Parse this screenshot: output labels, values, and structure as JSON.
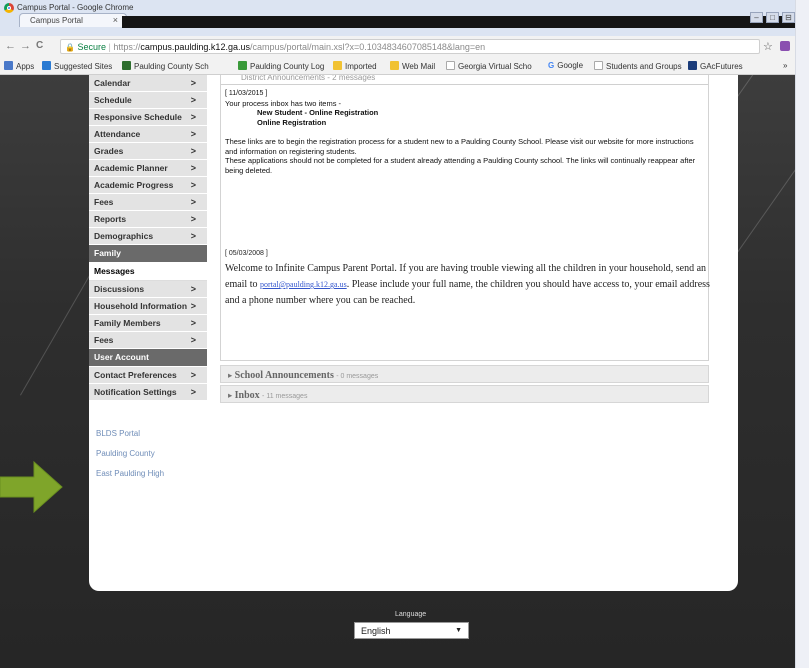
{
  "window": {
    "title": "Campus Portal - Google Chrome",
    "tab_title": "Campus Portal",
    "tab_close": "×",
    "buttons": [
      "–",
      "□",
      "⊟"
    ]
  },
  "toolbar": {
    "back": "←",
    "forward": "→",
    "reload": "C",
    "secure_label": "Secure",
    "url_scheme": "https://",
    "url_host": "campus.paulding.k12.ga.us",
    "url_rest": "/campus/portal/main.xsl?x=0.1034834607085148&lang=en",
    "star": "☆"
  },
  "bookmarks": [
    {
      "label": "Apps",
      "color": "#4a79c9"
    },
    {
      "label": "Suggested Sites",
      "color": "#2a7ad2"
    },
    {
      "label": "Paulding County Sch",
      "color": "#2e6e2e"
    },
    {
      "label": "Paulding County Log",
      "color": "#3a9a3a"
    },
    {
      "label": "Imported",
      "color": "#f1c232"
    },
    {
      "label": "Web Mail",
      "color": "#f1c232"
    },
    {
      "label": "Georgia Virtual Scho",
      "color": "#ffffff"
    },
    {
      "label": "Google",
      "color": "#4285f4"
    },
    {
      "label": "Students and Groups",
      "color": "#ffffff"
    },
    {
      "label": "GAcFutures",
      "color": "#1b3c7a"
    },
    {
      "label": "»",
      "color": ""
    }
  ],
  "sidebar": {
    "items_top": [
      {
        "label": "Calendar"
      },
      {
        "label": "Schedule"
      },
      {
        "label": "Responsive Schedule"
      },
      {
        "label": "Attendance"
      },
      {
        "label": "Grades"
      },
      {
        "label": "Academic Planner"
      },
      {
        "label": "Academic Progress"
      },
      {
        "label": "Fees"
      },
      {
        "label": "Reports"
      },
      {
        "label": "Demographics"
      }
    ],
    "family_header": "Family",
    "active_item": "Messages",
    "items_family": [
      {
        "label": "Discussions"
      },
      {
        "label": "Household Information"
      },
      {
        "label": "Family Members"
      },
      {
        "label": "Fees"
      }
    ],
    "account_header": "User Account",
    "items_account": [
      {
        "label": "Contact Preferences"
      },
      {
        "label": "Notification Settings"
      }
    ],
    "links": [
      "BLDS Portal",
      "Paulding County",
      "East Paulding High"
    ],
    "chevron": ">"
  },
  "content": {
    "panel_header": "District Announcements - 2 messages",
    "msg1": {
      "date": "[ 11/03/2015 ]",
      "line1": "Your process inbox has two items -",
      "item1": "New Student - Online Registration",
      "item2": "Online Registration",
      "para1": "These links are to begin the registration process for a student new to a Paulding County School.  Please visit our website for more instructions and information on registering students.",
      "para2": "These applications should not be completed for a student already attending a Paulding County school.  The links will continually reappear after being deleted."
    },
    "msg2": {
      "date": "[ 05/03/2008 ]",
      "text_before": "Welcome to Infinite Campus Parent Portal.  If you are having trouble viewing all the children in your household, send an email to ",
      "email": "portal@paulding.k12.ga.us",
      "text_after": ".  Please include your full name, the children you should have access to, your email address and a phone number where you can be reached."
    },
    "school_announcements": {
      "title": "School Announcements",
      "count": "- 0 messages"
    },
    "inbox": {
      "title": "Inbox",
      "count": "- 11 messages"
    }
  },
  "language": {
    "label": "Language",
    "selected": "English",
    "caret": "▼"
  },
  "colors": {
    "arrow": "#7fa52a",
    "page_bg": "#2e2e2e",
    "side_bg": "#e3e3e3",
    "side_header": "#6a6a6a"
  }
}
